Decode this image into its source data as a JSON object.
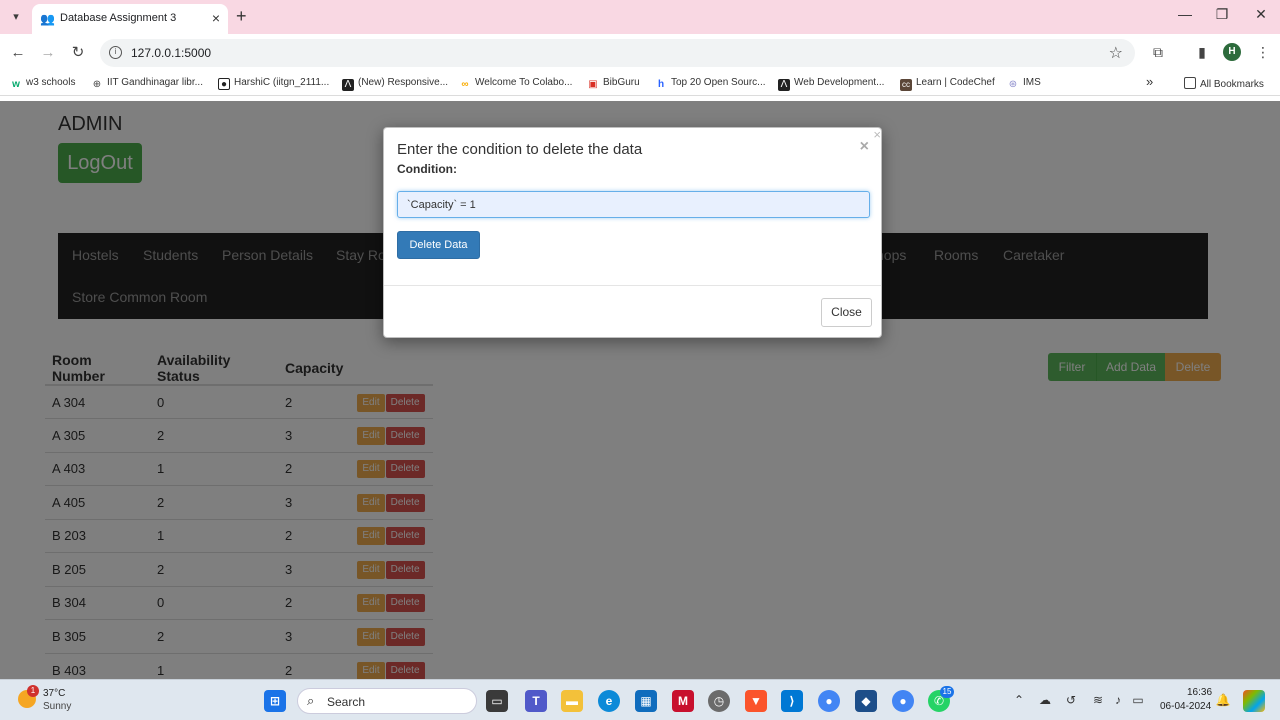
{
  "browser": {
    "tab_title": "Database Assignment 3",
    "tab_close": "×",
    "new_tab": "+",
    "url": "127.0.0.1:5000",
    "profile_initial": "H",
    "bookmarks": [
      {
        "label": "w3 schools",
        "icon": "w3-icon",
        "color": "#04aa6d"
      },
      {
        "label": "IIT Gandhinagar libr...",
        "icon": "globe-icon",
        "color": "#444444"
      },
      {
        "label": "HarshiC (iitgn_2111...",
        "icon": "github-icon",
        "color": "#222222"
      },
      {
        "label": "(New) Responsive...",
        "icon": "bookmark-icon",
        "color": "#222222"
      },
      {
        "label": "Welcome To Colabo...",
        "icon": "colab-icon",
        "color": "#f9ab00"
      },
      {
        "label": "BibGuru",
        "icon": "bibguru-icon",
        "color": "#d93025"
      },
      {
        "label": "Top 20 Open Sourc...",
        "icon": "hashnode-icon",
        "color": "#2962ff"
      },
      {
        "label": "Web Development...",
        "icon": "bookmark-icon",
        "color": "#222222"
      },
      {
        "label": "Learn | CodeChef",
        "icon": "codechef-icon",
        "color": "#5b4638"
      },
      {
        "label": "IMS",
        "icon": "globe-icon",
        "color": "#8a8acb"
      }
    ],
    "bookmarks_more": "»",
    "all_bookmarks": "All Bookmarks"
  },
  "page": {
    "admin_label": "ADMIN",
    "logout_label": "LogOut",
    "nav": [
      {
        "label": "Hostels"
      },
      {
        "label": "Students"
      },
      {
        "label": "Person Details"
      },
      {
        "label": "Stay Ro"
      },
      {
        "label": "hops"
      },
      {
        "label": "Rooms"
      },
      {
        "label": "Caretaker"
      },
      {
        "label": "Store Common Room"
      }
    ],
    "actions": {
      "filter": "Filter",
      "add": "Add Data",
      "delete": "Delete"
    },
    "table": {
      "headers": [
        "Room Number",
        "Availability Status",
        "Capacity"
      ],
      "row_edit": "Edit",
      "row_delete": "Delete",
      "rows": [
        [
          "A 304",
          "0",
          "2"
        ],
        [
          "A 305",
          "2",
          "3"
        ],
        [
          "A 403",
          "1",
          "2"
        ],
        [
          "A 405",
          "2",
          "3"
        ],
        [
          "B 203",
          "1",
          "2"
        ],
        [
          "B 205",
          "2",
          "3"
        ],
        [
          "B 304",
          "0",
          "2"
        ],
        [
          "B 305",
          "2",
          "3"
        ],
        [
          "B 403",
          "1",
          "2"
        ]
      ]
    }
  },
  "modal": {
    "title": "Enter the condition to delete the data",
    "condition_label": "Condition:",
    "condition_value": "`Capacity` = 1",
    "delete_button": "Delete Data",
    "close_button": "Close",
    "close_x": "×"
  },
  "taskbar": {
    "weather_temp": "37°C",
    "weather_cond": "Sunny",
    "weather_badge": "1",
    "search_label": "Search",
    "time": "16:36",
    "date": "06-04-2024",
    "whatsapp_badge": "15"
  },
  "colors": {
    "navbar_bg": "#222222",
    "success": "#5cb85c",
    "warning": "#f0ad4e",
    "danger": "#d9534f",
    "primary": "#337ab7"
  }
}
